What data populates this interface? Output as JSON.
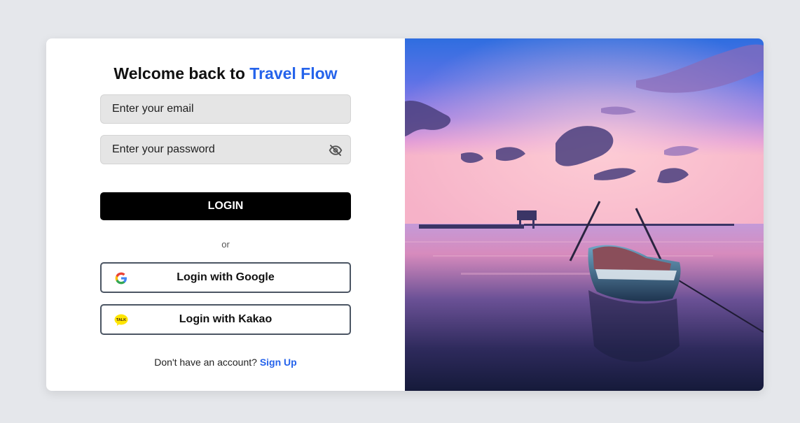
{
  "login": {
    "heading_prefix": "Welcome back to",
    "heading_brand": "Travel Flow",
    "email_placeholder": "Enter your email",
    "password_placeholder": "Enter your password",
    "password_toggle_icon": "eye-off-icon",
    "login_button": "LOGIN",
    "divider_text": "or",
    "google_button": "Login with Google",
    "google_icon": "google-logo-icon",
    "kakao_button": "Login with Kakao",
    "kakao_icon": "kakao-talk-icon",
    "kakao_badge_text": "TALK",
    "signup_prompt": "Don't have an account?",
    "signup_link": "Sign Up"
  },
  "hero_image": {
    "subject": "Boat on a calm sea at sunset with a purple and pink sky"
  },
  "colors": {
    "page_background": "#e5e7eb",
    "brand_accent": "#2563eb",
    "login_button_bg": "#000000",
    "input_bg": "#e5e5e5",
    "kakao_yellow": "#fee500"
  }
}
